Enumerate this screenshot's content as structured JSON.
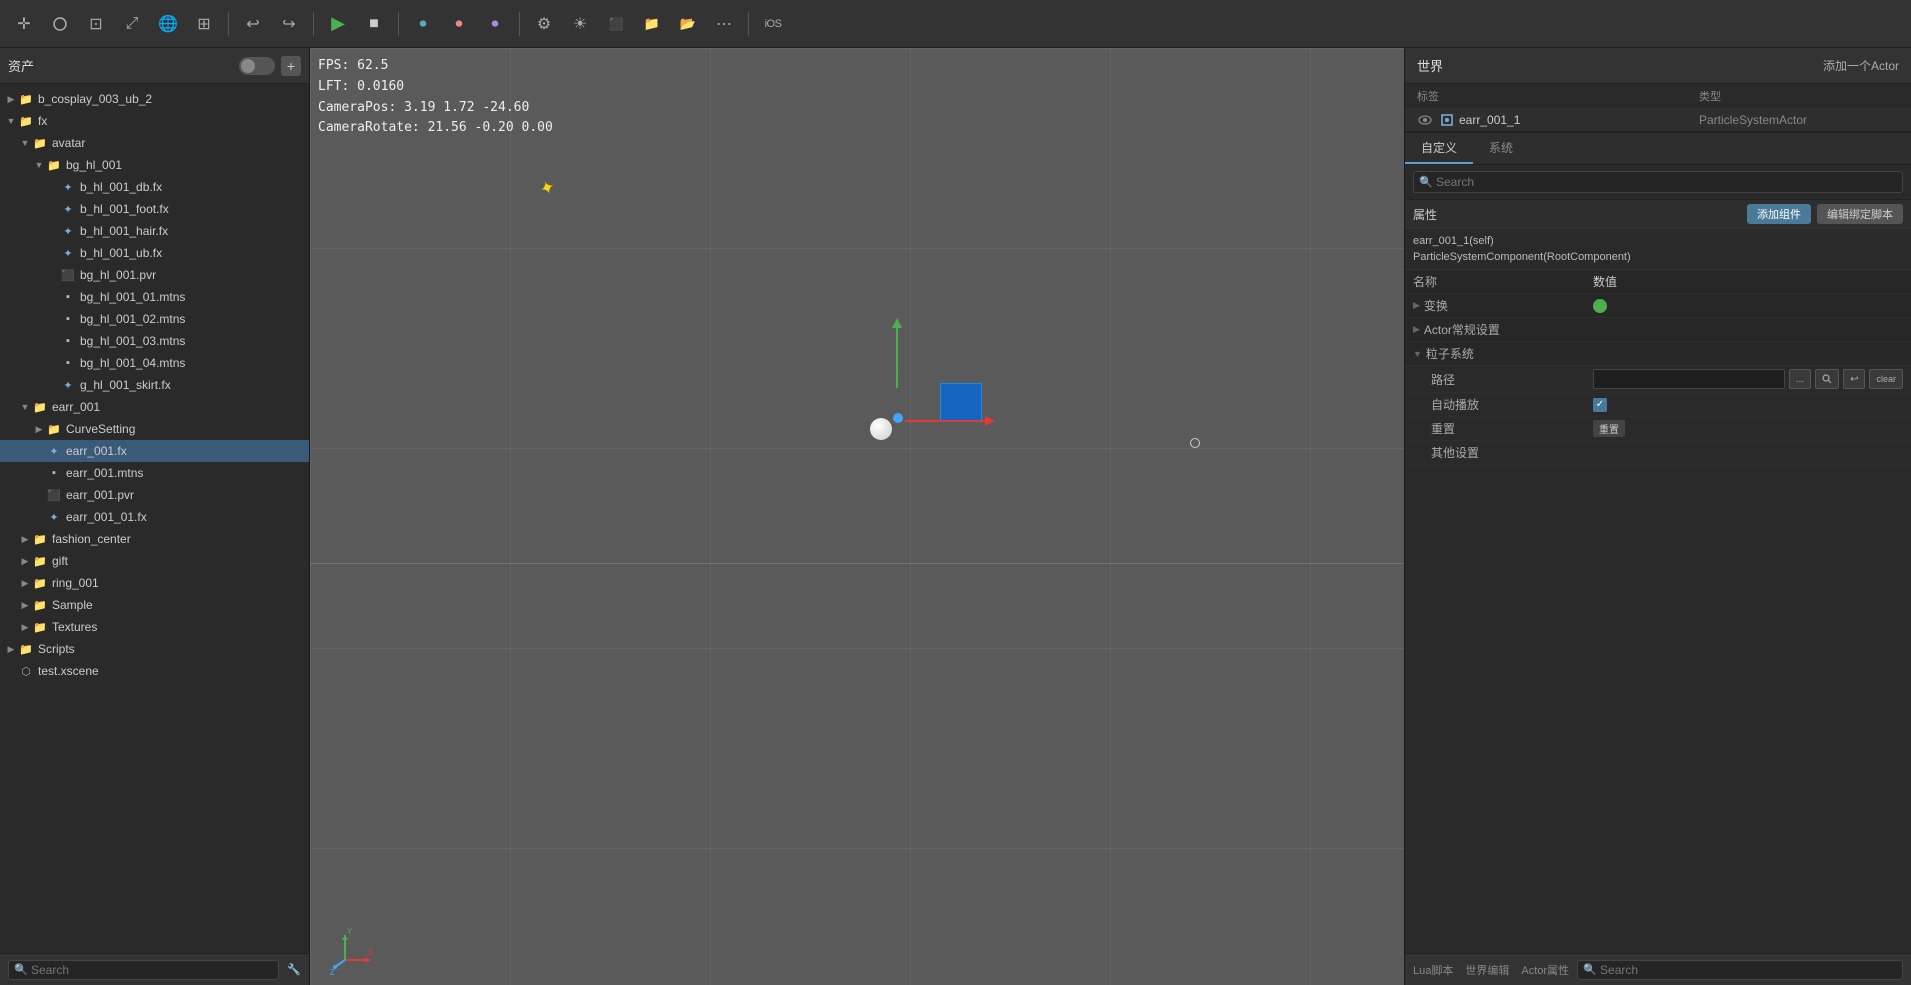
{
  "toolbar": {
    "tools": [
      {
        "id": "move",
        "icon": "✛",
        "title": "Move"
      },
      {
        "id": "rotate",
        "icon": "↻",
        "title": "Rotate"
      },
      {
        "id": "scale",
        "icon": "⊡",
        "title": "Scale"
      },
      {
        "id": "world",
        "icon": "⤢",
        "title": "World"
      },
      {
        "id": "grid",
        "icon": "⊞",
        "title": "Grid"
      },
      {
        "id": "snap",
        "icon": "⊞",
        "title": "Snap"
      },
      {
        "id": "undo",
        "icon": "↩",
        "title": "Undo"
      },
      {
        "id": "redo",
        "icon": "↪",
        "title": "Redo"
      },
      {
        "id": "play",
        "icon": "▶",
        "title": "Play"
      },
      {
        "id": "stop",
        "icon": "■",
        "title": "Stop"
      },
      {
        "id": "rec1",
        "icon": "⏺",
        "title": "Record1"
      },
      {
        "id": "rec2",
        "icon": "⏺",
        "title": "Record2"
      },
      {
        "id": "rec3",
        "icon": "⏺",
        "title": "Record3"
      },
      {
        "id": "settings",
        "icon": "⚙",
        "title": "Settings"
      },
      {
        "id": "light",
        "icon": "☀",
        "title": "Light"
      },
      {
        "id": "render",
        "icon": "⬛",
        "title": "Render"
      },
      {
        "id": "folder-open",
        "icon": "📁",
        "title": "Open Folder"
      },
      {
        "id": "folder-new",
        "icon": "📂",
        "title": "New Folder"
      },
      {
        "id": "more",
        "icon": "⋯",
        "title": "More"
      },
      {
        "id": "ios",
        "icon": "iOS",
        "title": "iOS"
      }
    ]
  },
  "left_panel": {
    "title": "资产",
    "add_btn": "+",
    "tree": [
      {
        "id": "b_cosplay_003_ub_2",
        "label": "b_cosplay_003_ub_2",
        "type": "folder",
        "level": 0,
        "expanded": false,
        "arrow": "▶"
      },
      {
        "id": "fx",
        "label": "fx",
        "type": "folder",
        "level": 0,
        "expanded": true,
        "arrow": "▼"
      },
      {
        "id": "avatar",
        "label": "avatar",
        "type": "folder",
        "level": 1,
        "expanded": true,
        "arrow": "▼"
      },
      {
        "id": "bg_hl_001",
        "label": "bg_hl_001",
        "type": "folder",
        "level": 2,
        "expanded": true,
        "arrow": "▼"
      },
      {
        "id": "b_hl_001_db.fx",
        "label": "b_hl_001_db.fx",
        "type": "fx",
        "level": 3,
        "expanded": false,
        "arrow": ""
      },
      {
        "id": "b_hl_001_foot.fx",
        "label": "b_hl_001_foot.fx",
        "type": "fx",
        "level": 3,
        "expanded": false,
        "arrow": ""
      },
      {
        "id": "b_hl_001_hair.fx",
        "label": "b_hl_001_hair.fx",
        "type": "fx",
        "level": 3,
        "expanded": false,
        "arrow": ""
      },
      {
        "id": "b_hl_001_ub.fx",
        "label": "b_hl_001_ub.fx",
        "type": "fx",
        "level": 3,
        "expanded": false,
        "arrow": ""
      },
      {
        "id": "bg_hl_001.pvr",
        "label": "bg_hl_001.pvr",
        "type": "pvr",
        "level": 3,
        "expanded": false,
        "arrow": ""
      },
      {
        "id": "bg_hl_001_01.mtns",
        "label": "bg_hl_001_01.mtns",
        "type": "mtns",
        "level": 3,
        "expanded": false,
        "arrow": ""
      },
      {
        "id": "bg_hl_001_02.mtns",
        "label": "bg_hl_001_02.mtns",
        "type": "mtns",
        "level": 3,
        "expanded": false,
        "arrow": ""
      },
      {
        "id": "bg_hl_001_03.mtns",
        "label": "bg_hl_001_03.mtns",
        "type": "mtns",
        "level": 3,
        "expanded": false,
        "arrow": ""
      },
      {
        "id": "bg_hl_001_04.mtns",
        "label": "bg_hl_001_04.mtns",
        "type": "mtns",
        "level": 3,
        "expanded": false,
        "arrow": ""
      },
      {
        "id": "g_hl_001_skirt.fx",
        "label": "g_hl_001_skirt.fx",
        "type": "fx",
        "level": 3,
        "expanded": false,
        "arrow": ""
      },
      {
        "id": "earr_001",
        "label": "earr_001",
        "type": "folder",
        "level": 1,
        "expanded": true,
        "arrow": "▼"
      },
      {
        "id": "CurveSetting",
        "label": "CurveSetting",
        "type": "folder",
        "level": 2,
        "expanded": false,
        "arrow": "▶"
      },
      {
        "id": "earr_001.fx",
        "label": "earr_001.fx",
        "type": "fx",
        "level": 2,
        "expanded": false,
        "arrow": "",
        "selected": true
      },
      {
        "id": "earr_001.mtns",
        "label": "earr_001.mtns",
        "type": "mtns",
        "level": 2,
        "expanded": false,
        "arrow": ""
      },
      {
        "id": "earr_001.pvr",
        "label": "earr_001.pvr",
        "type": "pvr",
        "level": 2,
        "expanded": false,
        "arrow": ""
      },
      {
        "id": "earr_001_01.fx",
        "label": "earr_001_01.fx",
        "type": "fx",
        "level": 2,
        "expanded": false,
        "arrow": ""
      },
      {
        "id": "fashion_center",
        "label": "fashion_center",
        "type": "folder",
        "level": 1,
        "expanded": false,
        "arrow": "▶"
      },
      {
        "id": "gift",
        "label": "gift",
        "type": "folder",
        "level": 1,
        "expanded": false,
        "arrow": "▶"
      },
      {
        "id": "ring_001",
        "label": "ring_001",
        "type": "folder",
        "level": 1,
        "expanded": false,
        "arrow": "▶"
      },
      {
        "id": "Sample",
        "label": "Sample",
        "type": "folder",
        "level": 1,
        "expanded": false,
        "arrow": "▶"
      },
      {
        "id": "Textures",
        "label": "Textures",
        "type": "folder",
        "level": 1,
        "expanded": false,
        "arrow": "▶"
      },
      {
        "id": "Scripts",
        "label": "Scripts",
        "type": "folder",
        "level": 0,
        "expanded": false,
        "arrow": "▶"
      },
      {
        "id": "test.xscene",
        "label": "test.xscene",
        "type": "scene",
        "level": 0,
        "expanded": false,
        "arrow": ""
      }
    ],
    "search_placeholder": "Search"
  },
  "viewport": {
    "fps": "FPS: 62.5",
    "lft": "LFT: 0.0160",
    "camera_pos": "CameraPos: 3.19  1.72  -24.60",
    "camera_rotate": "CameraRotate: 21.56  -0.20  0.00"
  },
  "right_panel": {
    "world_title": "世界",
    "add_actor_label": "添加一个Actor",
    "col_label": "标签",
    "col_type": "类型",
    "actors": [
      {
        "eye": "👁",
        "icon": "⬡",
        "label": "earr_001_1",
        "type": "ParticleSystemActor"
      }
    ],
    "tabs": [
      {
        "id": "custom",
        "label": "自定义",
        "active": true
      },
      {
        "id": "system",
        "label": "系统",
        "active": false
      }
    ],
    "search_placeholder": "Search",
    "properties_title": "属性",
    "add_component_label": "添加组件",
    "edit_script_label": "编辑绑定脚本",
    "components": [
      "earr_001_1(self)",
      "ParticleSystemComponent(RootComponent)"
    ],
    "prop_col_name": "名称",
    "prop_col_value": "数值",
    "prop_groups": [
      {
        "id": "transform",
        "label": "变换",
        "arrow": "▶",
        "collapsed": false,
        "has_color": true,
        "color": "#4caf50"
      },
      {
        "id": "actor-settings",
        "label": "Actor常规设置",
        "arrow": "▶",
        "collapsed": false
      },
      {
        "id": "particle-system",
        "label": "粒子系统",
        "arrow": "▼",
        "collapsed": true,
        "sub_props": [
          {
            "name": "路径",
            "value_type": "input_with_buttons",
            "value": "",
            "buttons": [
              "...",
              "🔍",
              "↩",
              "clear"
            ]
          },
          {
            "name": "自动播放",
            "value_type": "checkbox",
            "checked": true
          },
          {
            "name": "重置",
            "value_type": "tag",
            "tag_value": "重置"
          },
          {
            "name": "其他设置",
            "value_type": "text",
            "value": ""
          }
        ]
      }
    ],
    "bottom_tabs": [
      {
        "id": "lua-script",
        "label": "Lua脚本",
        "active": false
      },
      {
        "id": "world-editor",
        "label": "世界编辑",
        "active": false
      },
      {
        "id": "actor-props",
        "label": "Actor属性",
        "active": false
      }
    ],
    "search_bottom_placeholder": "Search"
  }
}
